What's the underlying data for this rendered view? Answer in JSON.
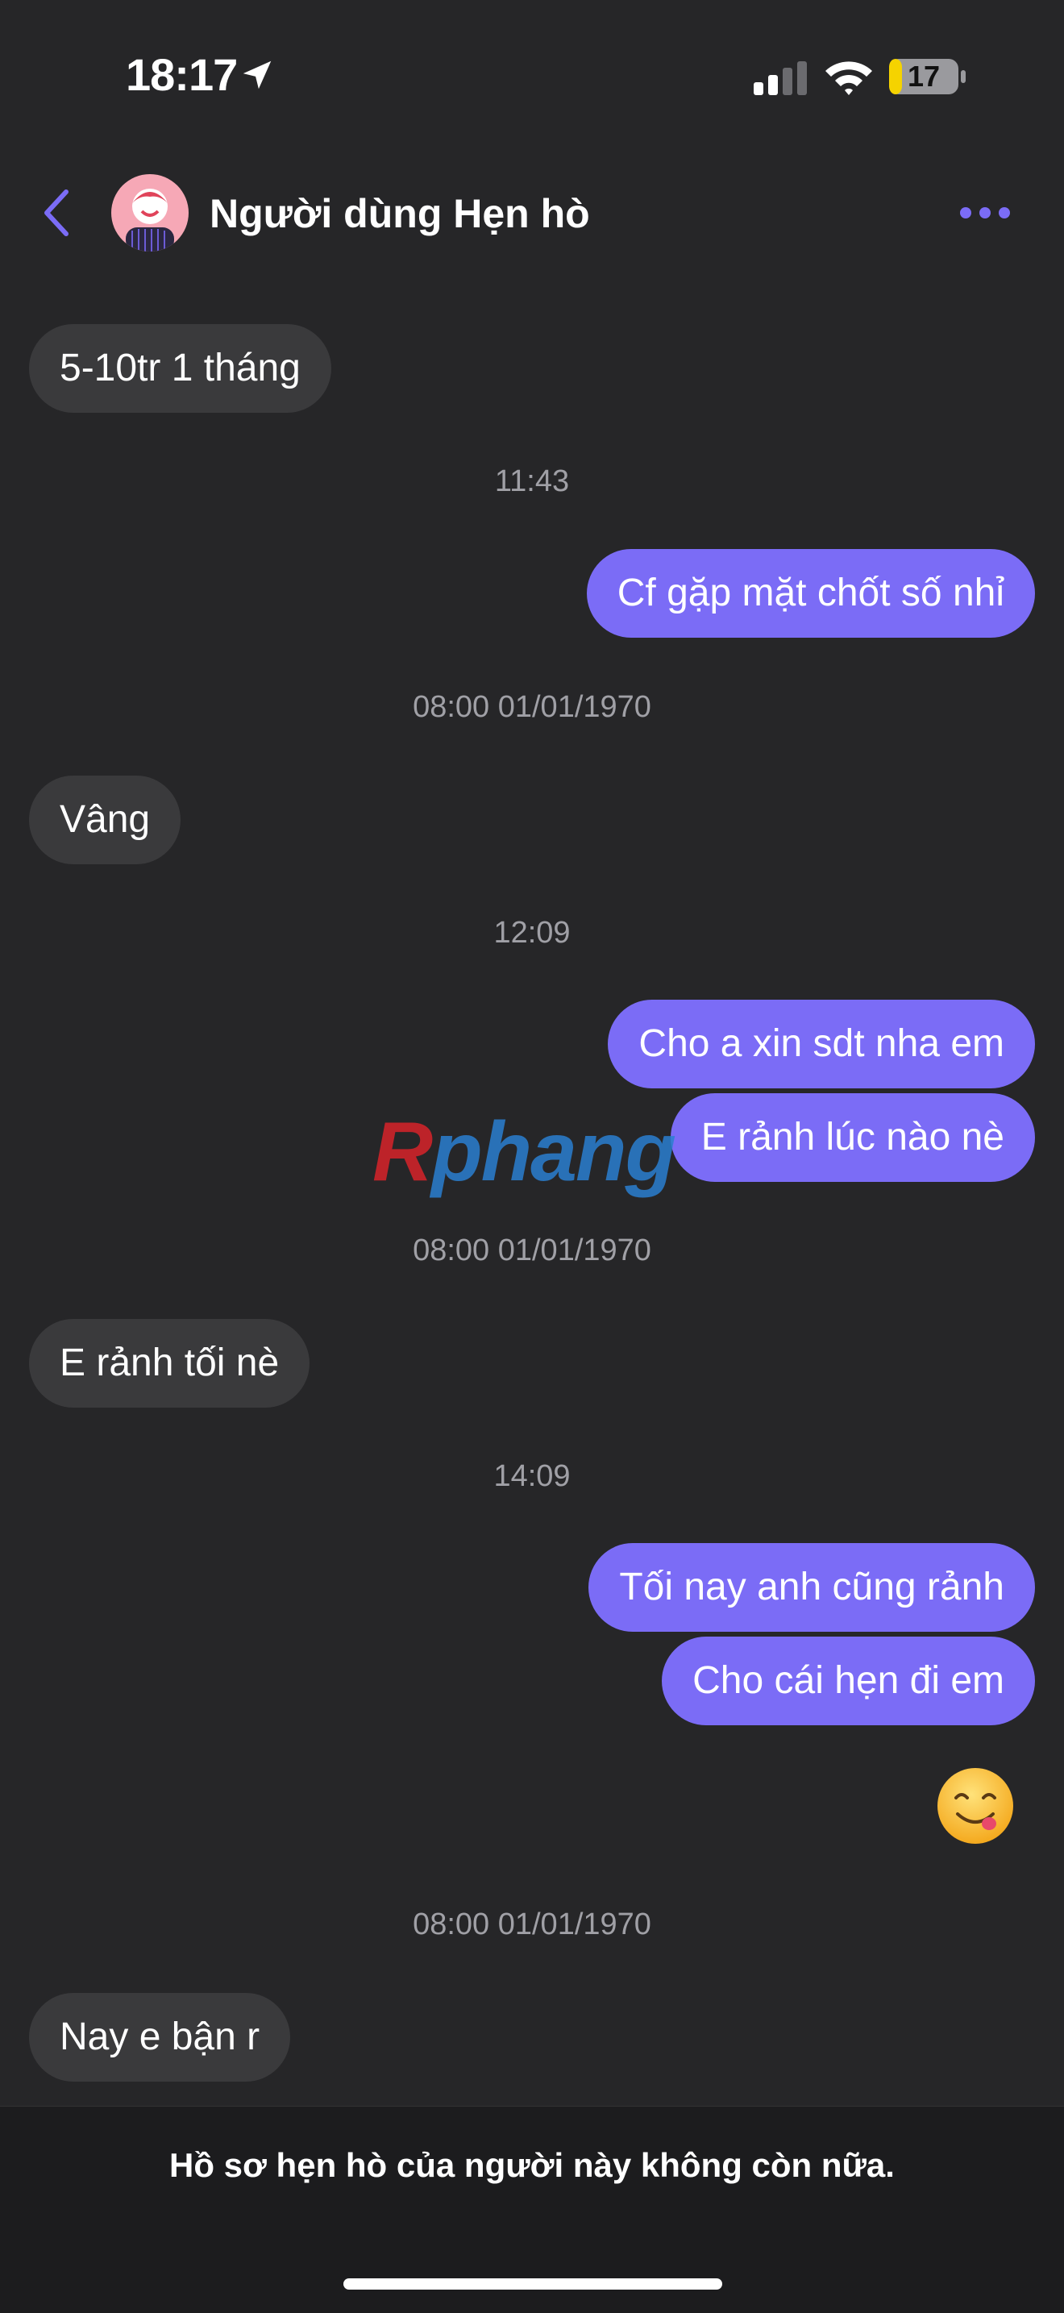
{
  "status_bar": {
    "time": "18:17",
    "battery": "17"
  },
  "header": {
    "title": "Người dùng Hẹn hò"
  },
  "messages": {
    "m1": "5-10tr 1 tháng",
    "t1": "11:43",
    "m2": "Cf gặp mặt chốt số nhỉ",
    "t2": "08:00 01/01/1970",
    "m3": "Vâng",
    "t3": "12:09",
    "m4": "Cho a xin sdt nha em",
    "m5": "E rảnh lúc nào nè",
    "t4": "08:00 01/01/1970",
    "m6": "E rảnh tối nè",
    "t5": "14:09",
    "m7": "Tối nay anh cũng rảnh",
    "m8": "Cho cái hẹn đi em",
    "t6": "08:00 01/01/1970",
    "m9": "Nay e bận r"
  },
  "watermark": {
    "first": "R",
    "rest": "phang"
  },
  "banner": {
    "text": "Hồ sơ hẹn hò của người này không còn nữa."
  },
  "colors": {
    "accent": "#7b6cf6",
    "incoming": "#3a3a3c",
    "background": "#262628"
  },
  "icons": [
    "location-arrow-icon",
    "signal-icon",
    "wifi-icon",
    "battery-icon",
    "back-chevron-icon",
    "more-dots-icon",
    "yum-emoji-icon"
  ]
}
